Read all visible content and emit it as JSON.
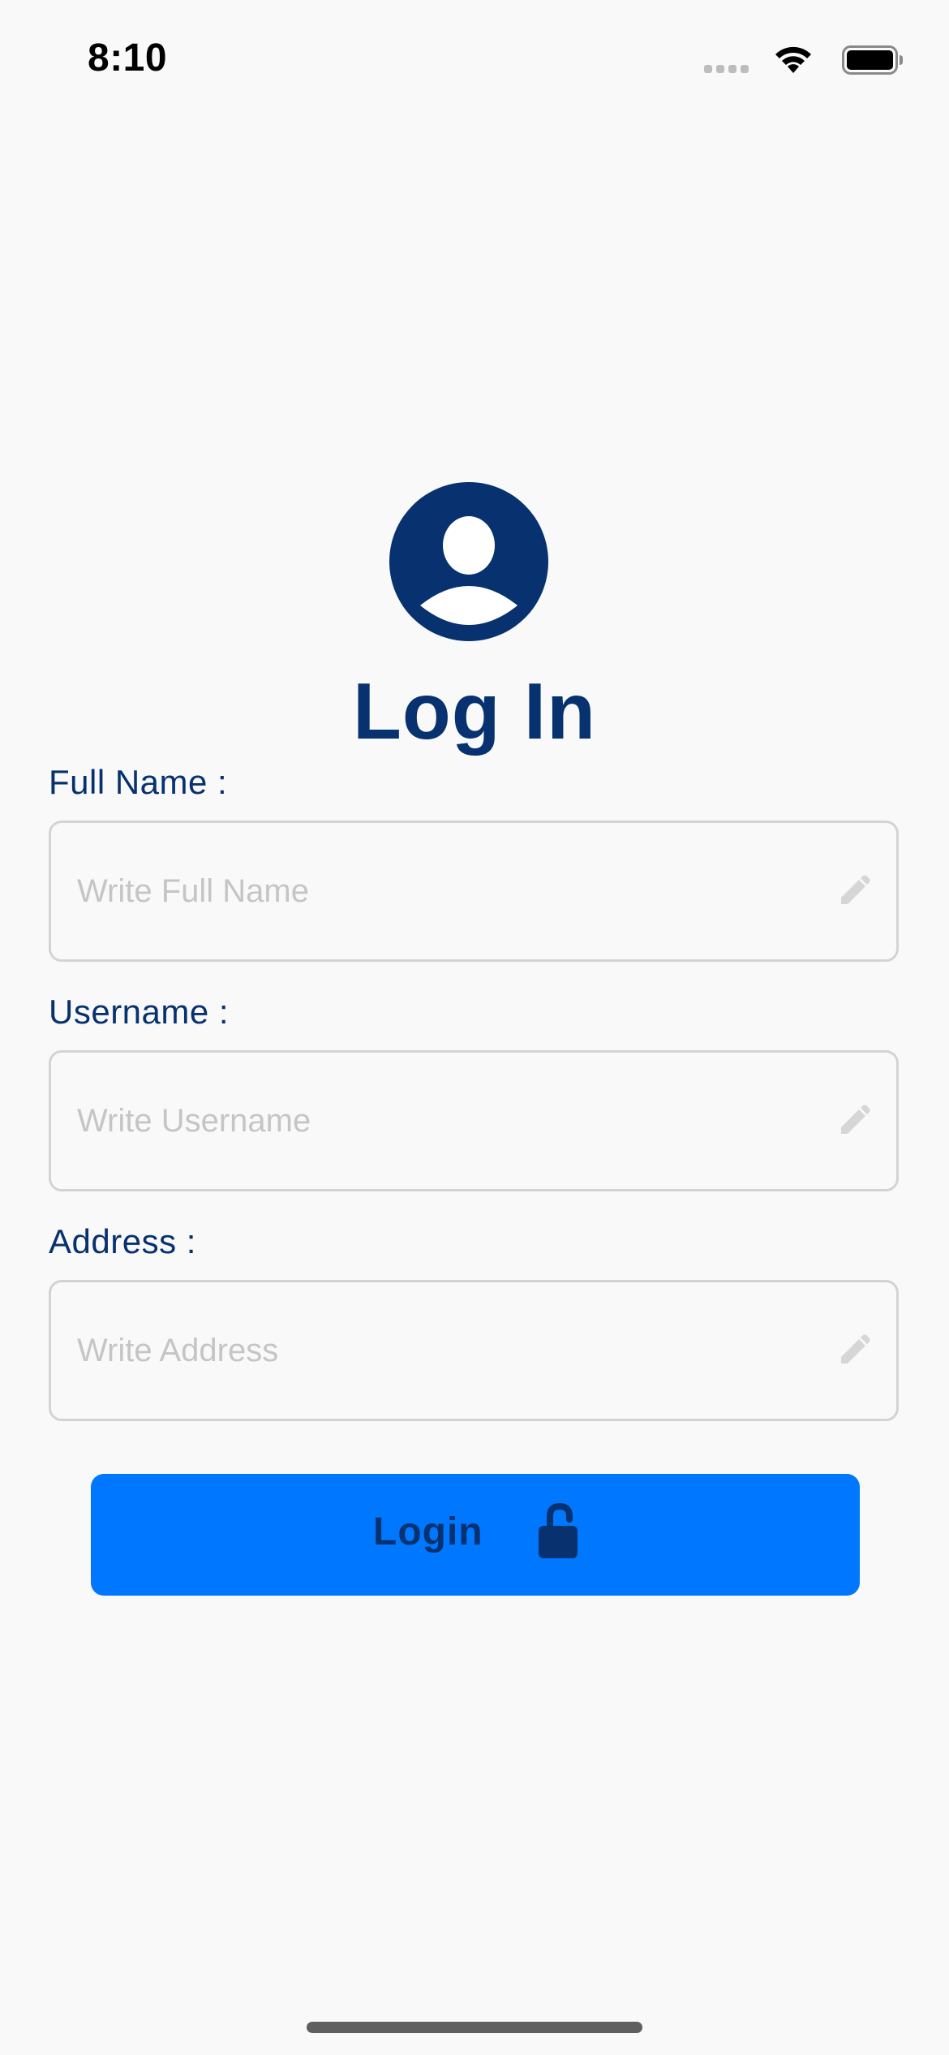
{
  "status_bar": {
    "time": "8:10"
  },
  "header": {
    "title": "Log In"
  },
  "form": {
    "fields": [
      {
        "label": "Full Name :",
        "placeholder": "Write Full Name",
        "value": ""
      },
      {
        "label": "Username :",
        "placeholder": "Write Username",
        "value": ""
      },
      {
        "label": "Address :",
        "placeholder": "Write Address",
        "value": ""
      }
    ],
    "submit_label": "Login"
  },
  "icons": {
    "avatar": "user-circle-icon",
    "field_edit": "pencil-icon",
    "submit": "unlock-icon"
  },
  "colors": {
    "primary_text": "#07316f",
    "button": "#0077ff",
    "background": "#f9f9f9",
    "placeholder": "#c5c5c5",
    "border": "#d3d3d3"
  }
}
